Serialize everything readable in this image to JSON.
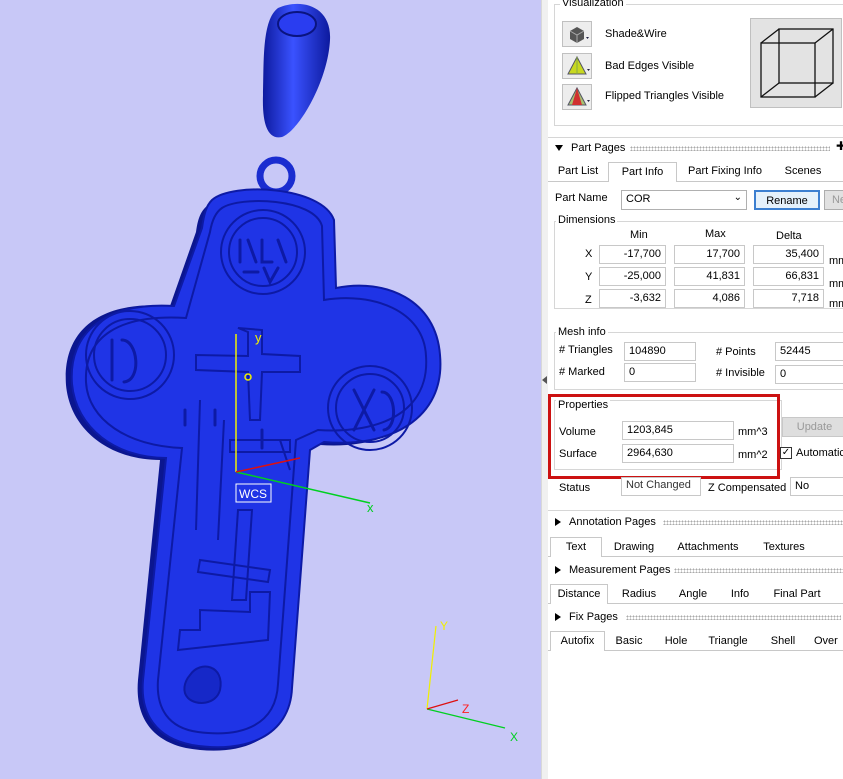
{
  "viewport": {
    "wcs_label": "WCS",
    "axis_x": "x",
    "axis_y": "y",
    "mini_axis_x": "X",
    "mini_axis_y": "Y",
    "mini_axis_z": "Z",
    "colors": {
      "background": "#c8c8f7",
      "model": "#1c2fd6",
      "highlight": "#cc1111"
    }
  },
  "visualization": {
    "title": "Visualization",
    "items": [
      {
        "label": "Shade&Wire",
        "icon": "cube-shade-icon"
      },
      {
        "label": "Bad Edges Visible",
        "icon": "bad-edges-icon"
      },
      {
        "label": "Flipped Triangles Visible",
        "icon": "flipped-triangles-icon"
      }
    ]
  },
  "part_pages": {
    "title": "Part Pages",
    "tabs": [
      "Part List",
      "Part Info",
      "Part Fixing Info",
      "Scenes"
    ],
    "selected_tab": "Part Info",
    "part_name_label": "Part Name",
    "part_name_value": "COR",
    "rename_button": "Rename",
    "next_button": "Ne",
    "dimensions": {
      "title": "Dimensions",
      "col_min": "Min",
      "col_max": "Max",
      "col_delta": "Delta",
      "unit": "mm",
      "rows": [
        {
          "axis": "X",
          "min": "-17,700",
          "max": "17,700",
          "delta": "35,400"
        },
        {
          "axis": "Y",
          "min": "-25,000",
          "max": "41,831",
          "delta": "66,831"
        },
        {
          "axis": "Z",
          "min": "-3,632",
          "max": "4,086",
          "delta": "7,718"
        }
      ]
    },
    "mesh_info": {
      "title": "Mesh info",
      "triangles_label": "# Triangles",
      "triangles_value": "104890",
      "points_label": "# Points",
      "points_value": "52445",
      "marked_label": "# Marked",
      "marked_value": "0",
      "invisible_label": "# Invisible",
      "invisible_value": "0"
    },
    "properties": {
      "title": "Properties",
      "volume_label": "Volume",
      "volume_value": "1203,845",
      "volume_unit": "mm^3",
      "surface_label": "Surface",
      "surface_value": "2964,630",
      "surface_unit": "mm^2",
      "update_button": "Update",
      "automatic_label": "Automatic",
      "automatic_checked": true
    },
    "status_label": "Status",
    "status_value": "Not Changed",
    "z_comp_label": "Z Compensated",
    "z_comp_value": "No"
  },
  "annotation_pages": {
    "title": "Annotation Pages",
    "tabs": [
      "Text",
      "Drawing",
      "Attachments",
      "Textures"
    ]
  },
  "measurement_pages": {
    "title": "Measurement Pages",
    "tabs": [
      "Distance",
      "Radius",
      "Angle",
      "Info",
      "Final Part"
    ]
  },
  "fix_pages": {
    "title": "Fix Pages",
    "tabs": [
      "Autofix",
      "Basic",
      "Hole",
      "Triangle",
      "Shell",
      "Over"
    ]
  }
}
